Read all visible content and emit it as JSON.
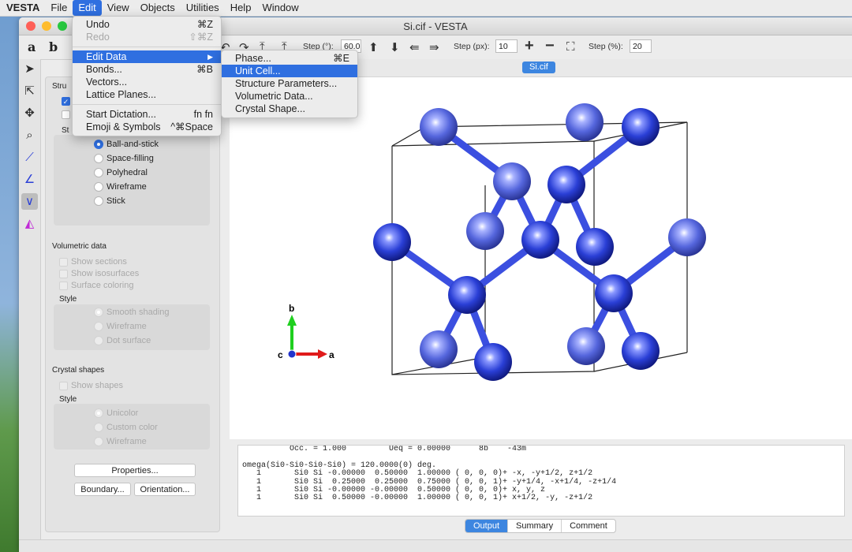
{
  "menubar": {
    "app": "VESTA",
    "items": [
      "File",
      "Edit",
      "View",
      "Objects",
      "Utilities",
      "Help",
      "Window"
    ]
  },
  "window": {
    "title": "Si.cif - VESTA"
  },
  "toolbar": {
    "a_label": "a",
    "b_label": "b",
    "step_deg_label": "Step (°):",
    "step_deg_value": "60.0",
    "step_px_label": "Step (px):",
    "step_px_value": "10",
    "step_pct_label": "Step (%):",
    "step_pct_value": "20"
  },
  "edit_menu": {
    "items": [
      {
        "label": "Undo",
        "shortcut": "⌘Z"
      },
      {
        "label": "Redo",
        "shortcut": "⇧⌘Z"
      },
      {
        "label": "Edit Data",
        "shortcut": "▶"
      },
      {
        "label": "Bonds...",
        "shortcut": "⌘B"
      },
      {
        "label": "Vectors...",
        "shortcut": ""
      },
      {
        "label": "Lattice Planes...",
        "shortcut": ""
      },
      {
        "label": "Start Dictation...",
        "shortcut": "fn fn"
      },
      {
        "label": "Emoji & Symbols",
        "shortcut": "^⌘Space"
      }
    ]
  },
  "edit_data_submenu": {
    "items": [
      {
        "label": "Phase...",
        "shortcut": "⌘E"
      },
      {
        "label": "Unit Cell...",
        "shortcut": ""
      },
      {
        "label": "Structure Parameters...",
        "shortcut": ""
      },
      {
        "label": "Volumetric Data...",
        "shortcut": ""
      },
      {
        "label": "Crystal Shape...",
        "shortcut": ""
      }
    ]
  },
  "side_panel": {
    "structure_title": "Stru",
    "style_short": "St",
    "style_options": [
      "Ball-and-stick",
      "Space-filling",
      "Polyhedral",
      "Wireframe",
      "Stick"
    ],
    "selected_style": "Ball-and-stick",
    "volumetric": {
      "title": "Volumetric data",
      "checks": [
        "Show sections",
        "Show isosurfaces",
        "Surface coloring"
      ],
      "style_label": "Style",
      "styles": [
        "Smooth shading",
        "Wireframe",
        "Dot surface"
      ]
    },
    "crystal": {
      "title": "Crystal shapes",
      "check": "Show shapes",
      "style_label": "Style",
      "styles": [
        "Unicolor",
        "Custom color",
        "Wireframe"
      ]
    },
    "buttons": {
      "properties": "Properties...",
      "boundary": "Boundary...",
      "orientation": "Orientation..."
    }
  },
  "viewport": {
    "file_tab": "Si.cif",
    "axes": {
      "a": "a",
      "b": "b",
      "c": "c"
    },
    "atom_color": "#2a3fd6",
    "bond_color": "#3b4fe0"
  },
  "output": {
    "lines": [
      "          Occ. = 1.000         Ueq = 0.00000      8b    -43m",
      "",
      "omega(Si0-Si0-Si0-Si0) = 120.0000(0) deg.",
      "   1       Si0 Si -0.00000  0.50000  1.00000 ( 0, 0, 0)+ -x, -y+1/2, z+1/2",
      "   1       Si0 Si  0.25000  0.25000  0.75000 ( 0, 0, 1)+ -y+1/4, -x+1/4, -z+1/4",
      "   1       Si0 Si -0.00000 -0.00000  0.50000 ( 0, 0, 0)+ x, y, z",
      "   1       Si0 Si  0.50000 -0.00000  1.00000 ( 0, 0, 1)+ x+1/2, -y, -z+1/2"
    ],
    "tabs": [
      "Output",
      "Summary",
      "Comment"
    ],
    "active_tab": "Output"
  }
}
